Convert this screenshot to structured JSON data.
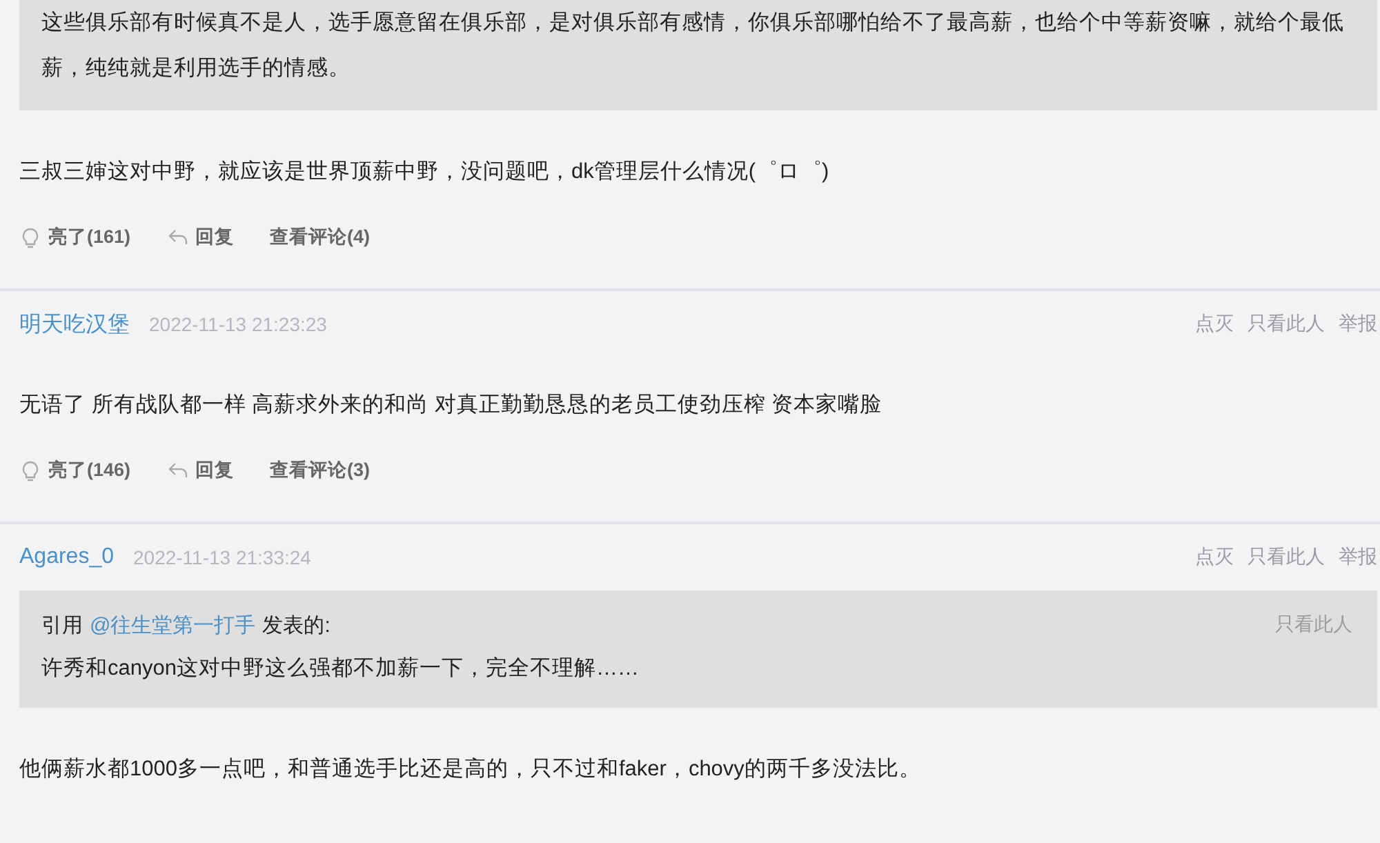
{
  "posts": [
    {
      "quote": {
        "text": "这些俱乐部有时候真不是人，选手愿意留在俱乐部，是对俱乐部有感情，你俱乐部哪怕给不了最高薪，也给个中等薪资嘛，就给个最低薪，纯纯就是利用选手的情感。"
      },
      "body": "三叔三婶这对中野，就应该是世界顶薪中野，没问题吧，dk管理层什么情况(゜ロ゜)",
      "footer": {
        "light": "亮了(161)",
        "reply": "回复",
        "comments": "查看评论(4)"
      }
    },
    {
      "header": {
        "user": "明天吃汉堡",
        "time": "2022-11-13 21:23:23",
        "links": [
          "点灭",
          "只看此人",
          "举报"
        ]
      },
      "body": "无语了 所有战队都一样 高薪求外来的和尚 对真正勤勤恳恳的老员工使劲压榨 资本家嘴脸",
      "footer": {
        "light": "亮了(146)",
        "reply": "回复",
        "comments": "查看评论(3)"
      }
    },
    {
      "header": {
        "user": "Agares_0",
        "time": "2022-11-13 21:33:24",
        "links": [
          "点灭",
          "只看此人",
          "举报"
        ]
      },
      "quote": {
        "cite_prefix": "引用",
        "author": "@往生堂第一打手",
        "cite_suffix": "发表的:",
        "only_this": "只看此人",
        "text": "许秀和canyon这对中野这么强都不加薪一下，完全不理解……"
      },
      "body": "他俩薪水都1000多一点吧，和普通选手比还是高的，只不过和faker，chovy的两千多没法比。"
    }
  ]
}
